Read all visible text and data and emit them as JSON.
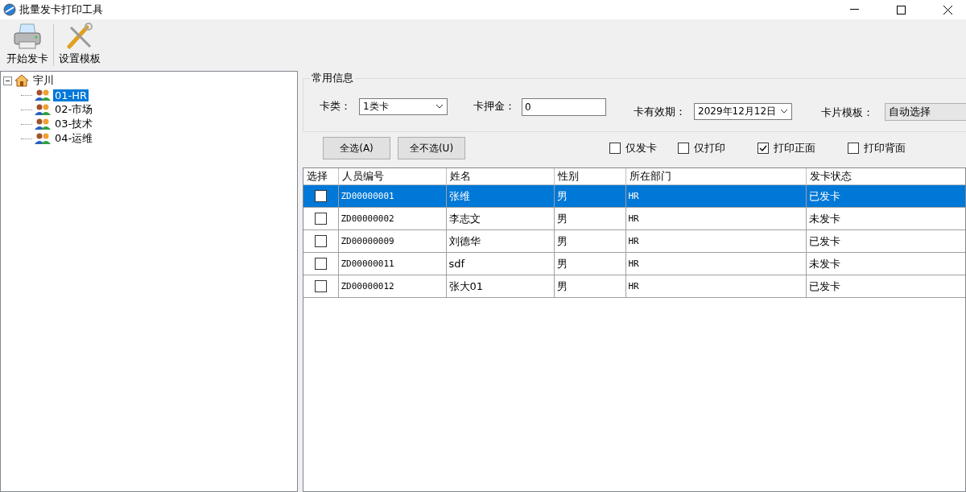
{
  "window": {
    "title": "批量发卡打印工具"
  },
  "toolbar": [
    {
      "kind": "printer",
      "label": "开始发卡"
    },
    {
      "kind": "tools",
      "label": "设置模板"
    }
  ],
  "tree": {
    "label": "宇川",
    "expanded": true,
    "children": [
      {
        "label": "01-HR",
        "selected": true
      },
      {
        "label": "02-市场",
        "selected": false
      },
      {
        "label": "03-技术",
        "selected": false
      },
      {
        "label": "04-运维",
        "selected": false
      }
    ]
  },
  "common_info": {
    "title": "常用信息",
    "card_type": {
      "label": "卡类：",
      "value": "1类卡"
    },
    "deposit": {
      "label": "卡押金：",
      "value": "0"
    },
    "expiry": {
      "label": "卡有效期：",
      "value": "2029年12月12日"
    },
    "template": {
      "label": "卡片模板：",
      "value": "自动选择"
    }
  },
  "buttons": [
    "全选(A)",
    "全不选(U)"
  ],
  "options": [
    {
      "label": "仅发卡",
      "checked": false
    },
    {
      "label": "仅打印",
      "checked": false
    },
    {
      "label": "打印正面",
      "checked": true
    },
    {
      "label": "打印背面",
      "checked": false
    }
  ],
  "table": {
    "columns": [
      "选择",
      "人员编号",
      "姓名",
      "性别",
      "所在部门",
      "发卡状态"
    ],
    "rows": [
      {
        "checked": false,
        "selected": true,
        "cells": [
          "",
          "ZD00000001",
          "张维",
          "男",
          "HR",
          "已发卡"
        ]
      },
      {
        "checked": false,
        "selected": false,
        "cells": [
          "",
          "ZD00000002",
          "李志文",
          "男",
          "HR",
          "未发卡"
        ]
      },
      {
        "checked": false,
        "selected": false,
        "cells": [
          "",
          "ZD00000009",
          "刘德华",
          "男",
          "HR",
          "已发卡"
        ]
      },
      {
        "checked": false,
        "selected": false,
        "cells": [
          "",
          "ZD00000011",
          "sdf",
          "男",
          "HR",
          "未发卡"
        ]
      },
      {
        "checked": false,
        "selected": false,
        "cells": [
          "",
          "ZD00000012",
          "张大01",
          "男",
          "HR",
          "已发卡"
        ]
      }
    ]
  }
}
